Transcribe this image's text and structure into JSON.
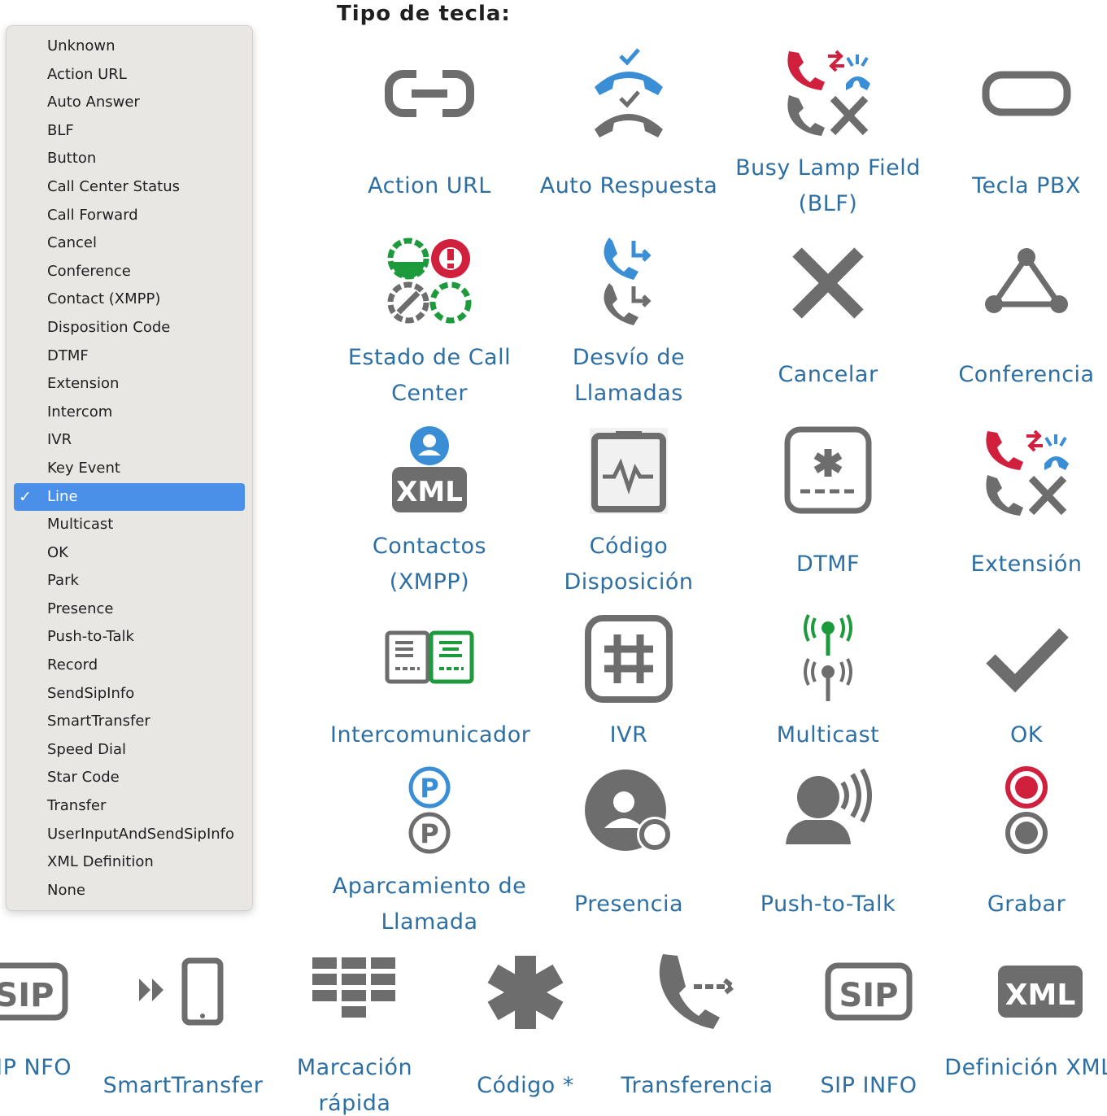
{
  "heading": "Tipo de tecla:",
  "menu": {
    "items": [
      "Unknown",
      "Action URL",
      "Auto Answer",
      "BLF",
      "Button",
      "Call Center Status",
      "Call Forward",
      "Cancel",
      "Conference",
      "Contact (XMPP)",
      "Disposition Code",
      "DTMF",
      "Extension",
      "Intercom",
      "IVR",
      "Key Event",
      "Line",
      "Multicast",
      "OK",
      "Park",
      "Presence",
      "Push-to-Talk",
      "Record",
      "SendSipInfo",
      "SmartTransfer",
      "Speed Dial",
      "Star Code",
      "Transfer",
      "UserInputAndSendSipInfo",
      "XML Definition",
      "None"
    ],
    "selected": "Line",
    "check_glyph": "✓"
  },
  "grid": {
    "r1": [
      "Action URL",
      "Auto Respuesta",
      "Busy Lamp Field (BLF)",
      "Tecla PBX"
    ],
    "r2": [
      "Estado de Call Center",
      "Desvío de Llamadas",
      "Cancelar",
      "Conferencia"
    ],
    "r3": [
      "Contactos (XMPP)",
      "Código Disposición",
      "DTMF",
      "Extensión"
    ],
    "r4": [
      "Intercomunicador",
      "IVR",
      "Multicast",
      "OK"
    ],
    "r5": [
      "Aparcamiento de Llamada",
      "Presencia",
      "Push-to-Talk",
      "Grabar"
    ],
    "r6": [
      "ar SIP NFO",
      "SmartTransfer",
      "Marcación rápida",
      "Código *",
      "Transferencia",
      "SIP INFO",
      "Definición XML"
    ]
  },
  "icon_text": {
    "xml": "XML",
    "sip": "SIP",
    "park": "P"
  },
  "colors": {
    "label": "#2e6fa3",
    "icon_gray": "#6d6d6d",
    "blue": "#3a8ed6",
    "red": "#d1203e",
    "green": "#1d9a3b",
    "menu_selected": "#4a8fe8"
  }
}
